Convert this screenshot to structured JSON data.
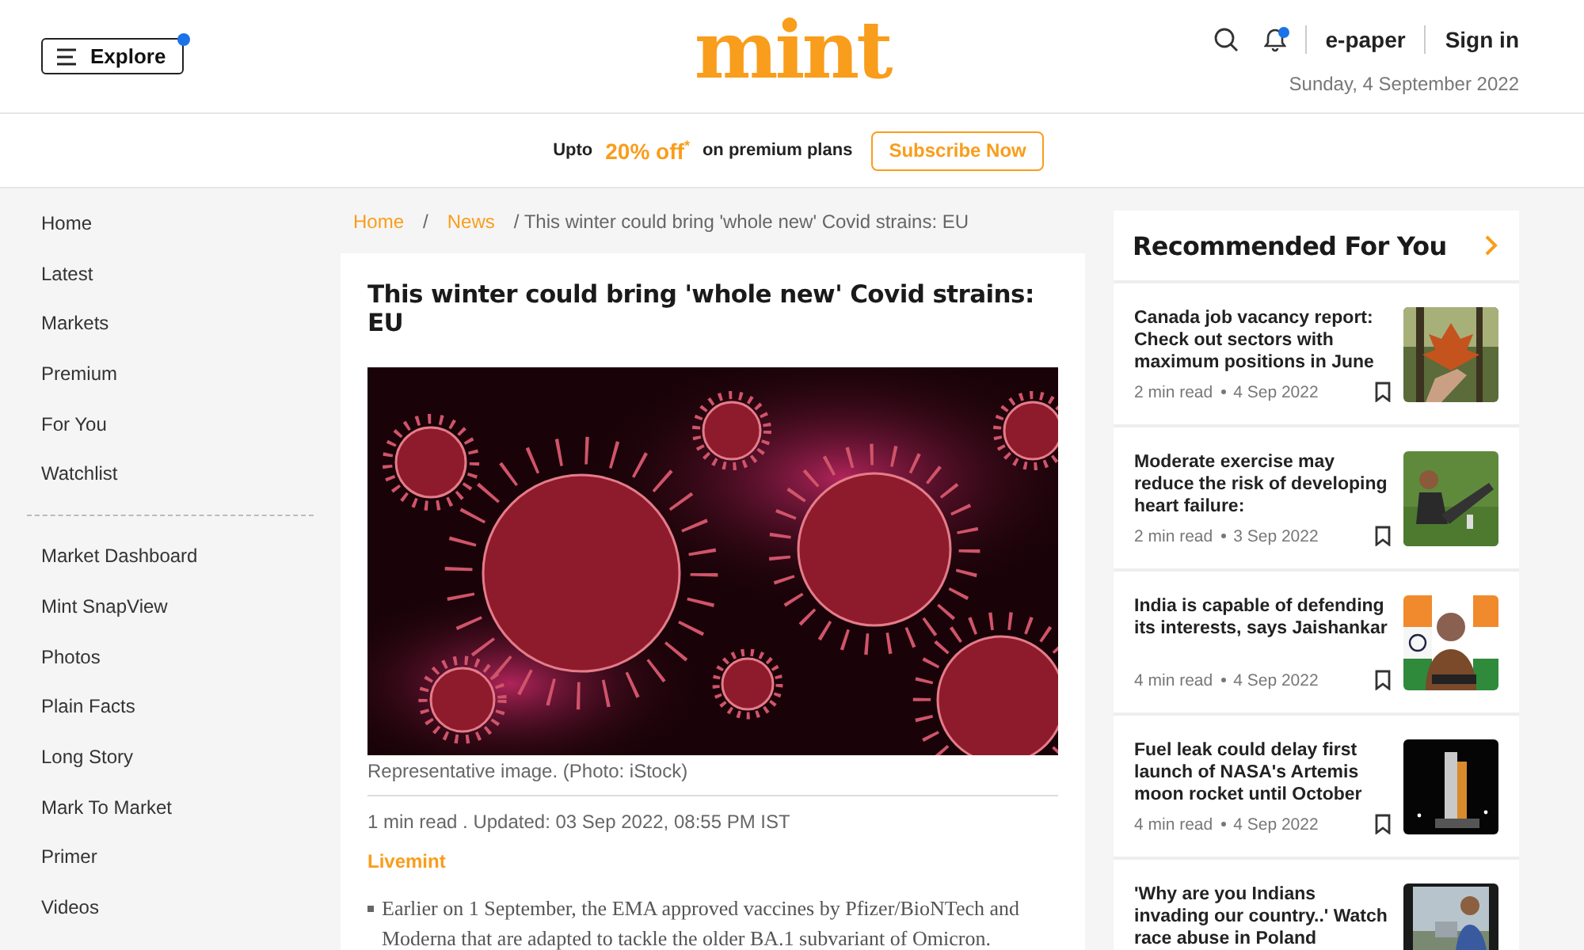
{
  "header": {
    "explore_button": {
      "label": "Explore",
      "notification": true
    },
    "logo": "mint",
    "bell_notification": true,
    "links": [
      "e-paper",
      "Sign in"
    ],
    "date": "Sunday, 4 September 2022"
  },
  "promo": {
    "prefix": "Upto",
    "offer": "20% off$^{*}$",
    "suffix": "on premium plans",
    "button": "Subscribe Now"
  },
  "sidebar": {
    "groups": [
      {
        "items": [
          "Home",
          "Latest",
          "Markets",
          "Premium",
          "For You",
          "Watchlist"
        ]
      },
      {
        "items": [
          "Market Dashboard",
          "Mint SnapView",
          "Photos",
          "Plain Facts",
          "Long Story",
          "Mark To Market",
          "Primer",
          "Videos"
        ]
      }
    ]
  },
  "breadcrumb": [
    {
      "kind": "link",
      "label": "Home"
    },
    {
      "kind": "separator",
      "label": "/"
    },
    {
      "kind": "link",
      "label": "News"
    },
    {
      "kind": "current",
      "label": "/ This winter could bring 'whole new' Covid strains: EU"
    }
  ],
  "article": {
    "title": "This winter could bring 'whole new' Covid strains: EU",
    "picture": {
      "kind": "picture"
    },
    "caption": "Representative image. (Photo: iStock)",
    "meta": "1 min read . Updated: 03 Sep 2022, 08:55 PM IST",
    "source": "Livemint",
    "bullets": [
      "Earlier on 1 September, the EMA approved vaccines by Pfizer/BioNTech and Moderna that are adapted to tackle the older BA.1 subvariant of Omicron."
    ]
  },
  "recommended": {
    "title": "Recommended For You",
    "items": [
      {
        "title": "Canada job vacancy report: Check out sectors with maximum positions in June",
        "read": "2 min read",
        "date": "4 Sep 2022"
      },
      {
        "title": "Moderate exercise may reduce the risk of developing heart failure:",
        "read": "2 min read",
        "date": "3 Sep 2022"
      },
      {
        "title": "India is capable of defending its interests, says Jaishankar",
        "read": "4 min read",
        "date": "4 Sep 2022"
      },
      {
        "title": "Fuel leak could delay first launch of NASA's Artemis moon rocket until October",
        "read": "4 min read",
        "date": "4 Sep 2022"
      },
      {
        "title": "'Why are you Indians invading our country..' Watch race abuse in Poland"
      }
    ]
  }
}
